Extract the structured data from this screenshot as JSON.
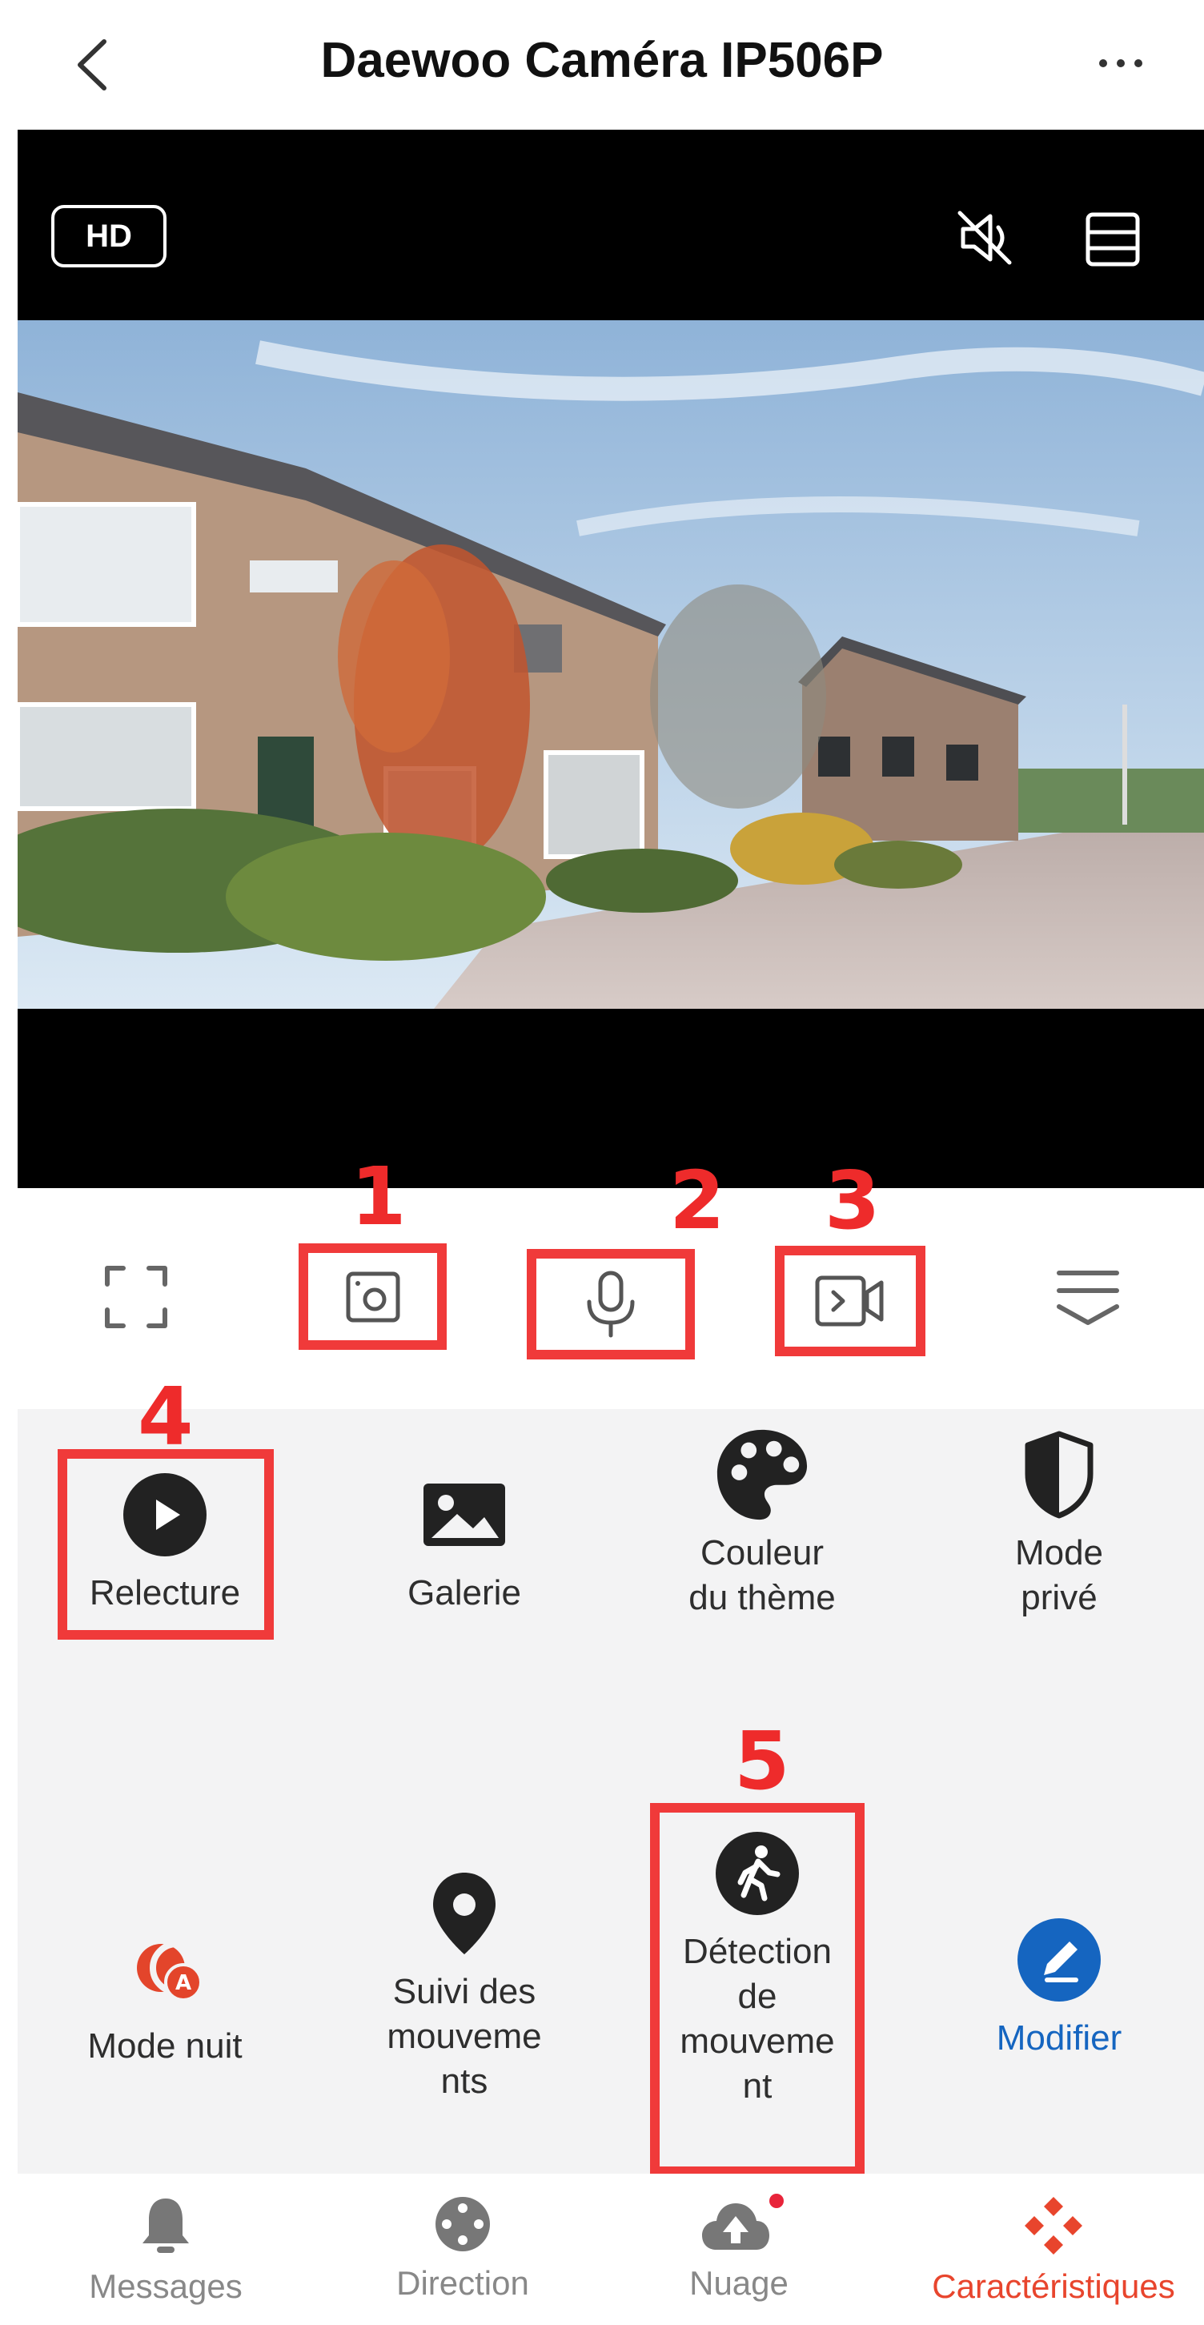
{
  "header": {
    "title": "Daewoo Caméra IP506P",
    "back_icon": "chevron-left-icon",
    "more_icon": "more-horizontal-icon"
  },
  "video": {
    "quality_label": "HD",
    "mute_icon": "speaker-muted-icon",
    "layout_icon": "split-view-icon"
  },
  "controls": {
    "fullscreen_icon": "fullscreen-icon",
    "snapshot_icon": "camera-snapshot-icon",
    "microphone_icon": "microphone-icon",
    "record_icon": "video-record-icon",
    "collapse_icon": "collapse-panel-icon"
  },
  "annotations": {
    "n1": "1",
    "n2": "2",
    "n3": "3",
    "n4": "4",
    "n5": "5"
  },
  "features": {
    "playback": {
      "label": "Relecture",
      "icon": "play-circle-icon"
    },
    "gallery": {
      "label": "Galerie",
      "icon": "image-icon"
    },
    "theme": {
      "label_line1": "Couleur",
      "label_line2": "du thème",
      "icon": "palette-icon"
    },
    "privacy": {
      "label_line1": "Mode",
      "label_line2": "privé",
      "icon": "shield-icon"
    },
    "night": {
      "label": "Mode nuit",
      "icon": "night-mode-icon",
      "badge": "A"
    },
    "tracking": {
      "label_line1": "Suivi des",
      "label_line2": "mouveme",
      "label_line3": "nts",
      "icon": "location-pin-icon"
    },
    "motion": {
      "label_line1": "Détection",
      "label_line2": "de",
      "label_line3": "mouveme",
      "label_line4": "nt",
      "icon": "walking-person-icon"
    },
    "edit": {
      "label": "Modifier",
      "icon": "pencil-icon"
    }
  },
  "bottom_nav": {
    "messages": {
      "label": "Messages",
      "icon": "bell-icon"
    },
    "direction": {
      "label": "Direction",
      "icon": "joystick-icon"
    },
    "cloud": {
      "label": "Nuage",
      "icon": "cloud-upload-icon",
      "has_notification": true
    },
    "features": {
      "label": "Caractéristiques",
      "icon": "features-icon",
      "active": true
    }
  },
  "colors": {
    "accent_red": "#ee2b2b",
    "nav_active": "#e8452d",
    "edit_blue": "#1565c0",
    "panel_bg": "#f3f3f4"
  }
}
